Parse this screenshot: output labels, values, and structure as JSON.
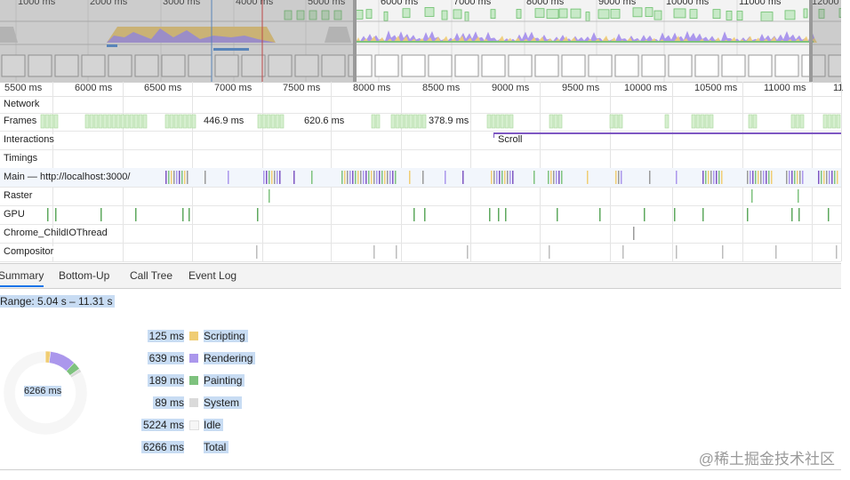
{
  "overview": {
    "ticks": [
      "1000 ms",
      "2000 ms",
      "3000 ms",
      "4000 ms",
      "5000 ms",
      "6000 ms",
      "7000 ms",
      "8000 ms",
      "9000 ms",
      "10000 ms",
      "11000 ms",
      "12000"
    ]
  },
  "ruler": {
    "ticks": [
      "5500 ms",
      "6000 ms",
      "6500 ms",
      "7000 ms",
      "7500 ms",
      "8000 ms",
      "8500 ms",
      "9000 ms",
      "9500 ms",
      "10000 ms",
      "10500 ms",
      "11000 ms",
      "11"
    ]
  },
  "tracks": {
    "network": "Network",
    "frames": "Frames",
    "frame_durations": [
      "446.9 ms",
      "620.6 ms",
      "378.9 ms"
    ],
    "interactions": "Interactions",
    "interaction_scroll": "Scroll",
    "timings": "Timings",
    "main": "Main — http://localhost:3000/",
    "raster": "Raster",
    "gpu": "GPU",
    "childio": "Chrome_ChildIOThread",
    "compositor": "Compositor"
  },
  "tabs": [
    "Summary",
    "Bottom-Up",
    "Call Tree",
    "Event Log"
  ],
  "active_tab": "Summary",
  "summary": {
    "range": "Range: 5.04 s – 11.31 s",
    "total_center": "6266 ms",
    "legend": [
      {
        "value": "125 ms",
        "name": "Scripting",
        "ms": 125,
        "color": "#f0cd74"
      },
      {
        "value": "639 ms",
        "name": "Rendering",
        "ms": 639,
        "color": "#ab97ec"
      },
      {
        "value": "189 ms",
        "name": "Painting",
        "ms": 189,
        "color": "#7ec27e"
      },
      {
        "value": "89 ms",
        "name": "System",
        "ms": 89,
        "color": "#dadada"
      },
      {
        "value": "5224 ms",
        "name": "Idle",
        "ms": 5224,
        "color": "#f6f6f6"
      },
      {
        "value": "6266 ms",
        "name": "Total",
        "ms": 6266,
        "color": ""
      }
    ]
  },
  "watermark": "@稀土掘金技术社区",
  "colors": {
    "scripting": "#f0cd74",
    "rendering": "#ab97ec",
    "painting": "#7ec27e",
    "system": "#dadada",
    "selection": "#c8dcf3",
    "accent": "#1a73e8"
  }
}
